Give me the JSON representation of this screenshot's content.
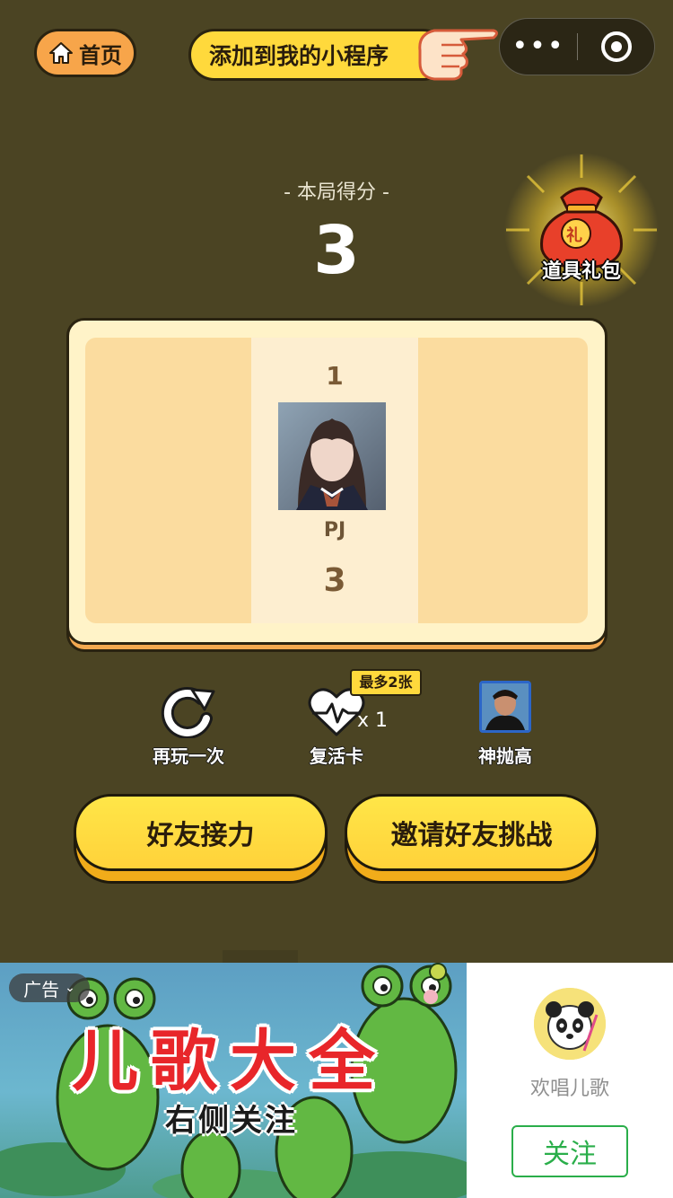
{
  "header": {
    "home_label": "首页",
    "add_mini_program_label": "添加到我的小程序",
    "menu_dots": "•••"
  },
  "score": {
    "title": "- 本局得分 -",
    "value": "3"
  },
  "gift": {
    "seal_char": "礼",
    "label": "道具礼包"
  },
  "ranking": [
    {
      "rank": "1",
      "name": "PJ",
      "score": "3"
    }
  ],
  "actions": {
    "replay_label": "再玩一次",
    "revive_label": "复活卡",
    "revive_count": "x 1",
    "revive_badge": "最多2张",
    "friend_label": "神抛高"
  },
  "buttons": {
    "relay_label": "好友接力",
    "challenge_label": "邀请好友挑战"
  },
  "ad": {
    "tag": "广告",
    "title": "儿歌大全",
    "subtitle": "右侧关注",
    "account_name": "欢唱儿歌",
    "follow_label": "关注"
  },
  "colors": {
    "background": "#4b4423",
    "button_yellow": "#ffd93c",
    "home_orange": "#f7a54a",
    "follow_green": "#2aae4a"
  }
}
